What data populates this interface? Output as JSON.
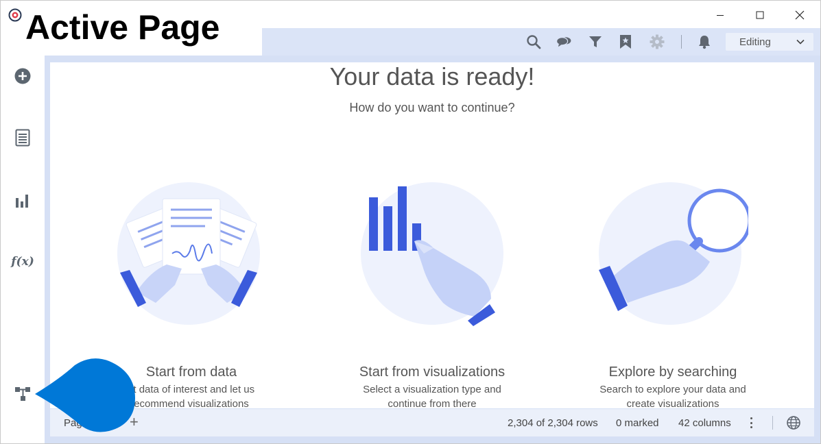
{
  "window": {
    "active_page_label": "Active Page",
    "controls": [
      "minimize",
      "maximize",
      "close"
    ]
  },
  "toolbar": {
    "icons": [
      "search-icon",
      "comments-icon",
      "filter-icon",
      "bookmark-icon",
      "settings-icon",
      "notification-icon"
    ],
    "mode": "Editing"
  },
  "sidebar": {
    "items": [
      "add-data-icon",
      "data-table-icon",
      "visualization-types-icon",
      "expression-icon"
    ],
    "fx_label": "f(x)"
  },
  "main": {
    "title": "Your data is ready!",
    "subtitle": "How do you want to continue?",
    "options": [
      {
        "title": "Start from data",
        "description_line1": "ct data of interest and let us",
        "description_line2": "ecommend visualizations"
      },
      {
        "title": "Start from visualizations",
        "description_line1": "Select a visualization type and",
        "description_line2": "continue from there"
      },
      {
        "title": "Explore by searching",
        "description_line1": "Search to explore your data and",
        "description_line2": "create visualizations"
      }
    ]
  },
  "statusbar": {
    "page_tab": "Pag",
    "add_page": "+",
    "rows": "2,304 of 2,304 rows",
    "marked": "0 marked",
    "columns": "42 columns"
  },
  "colors": {
    "accent": "#3b5bdb",
    "illustration_light": "#eef2fd",
    "toolbar_bg": "#dbe4f7",
    "pointer": "#0078d7"
  }
}
